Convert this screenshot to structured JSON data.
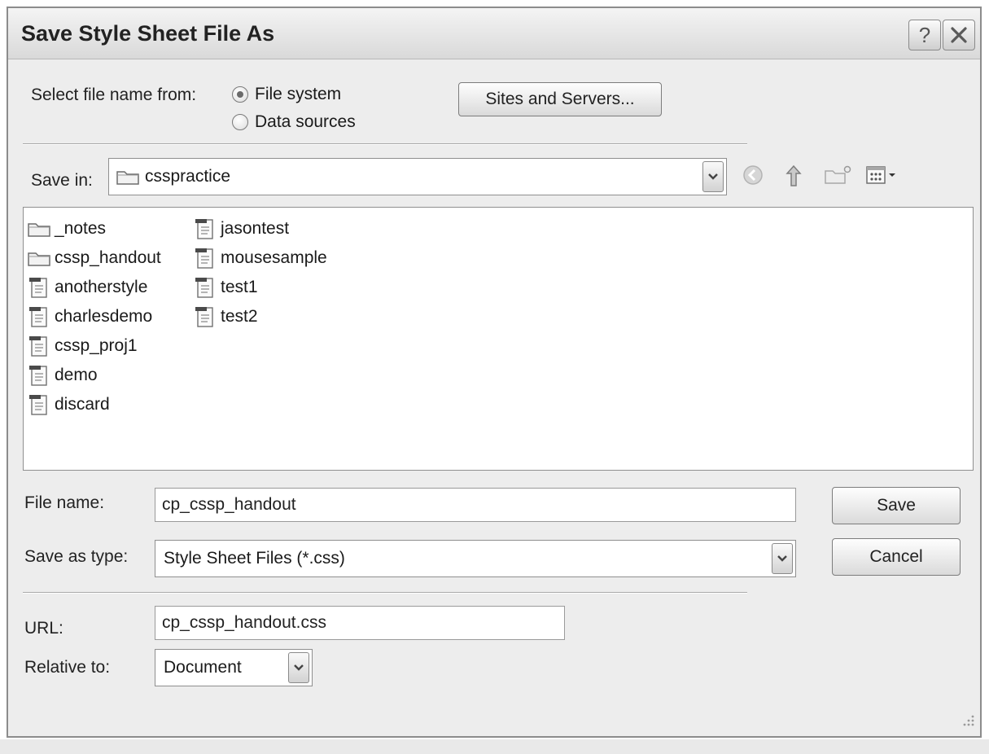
{
  "dialog": {
    "title": "Save Style Sheet File As",
    "help_label": "?"
  },
  "source": {
    "label": "Select file name from:",
    "options": [
      "File system",
      "Data sources"
    ],
    "selected": "File system",
    "sites_button": "Sites and Servers..."
  },
  "save_in": {
    "label": "Save in:",
    "folder": "csspractice"
  },
  "files": {
    "column1": [
      {
        "name": "_notes",
        "kind": "folder"
      },
      {
        "name": "cssp_handout",
        "kind": "folder"
      },
      {
        "name": "anotherstyle",
        "kind": "file"
      },
      {
        "name": "charlesdemo",
        "kind": "file"
      },
      {
        "name": "cssp_proj1",
        "kind": "file"
      },
      {
        "name": "demo",
        "kind": "file"
      },
      {
        "name": "discard",
        "kind": "file"
      }
    ],
    "column2": [
      {
        "name": "jasontest",
        "kind": "file"
      },
      {
        "name": "mousesample",
        "kind": "file"
      },
      {
        "name": "test1",
        "kind": "file"
      },
      {
        "name": "test2",
        "kind": "file"
      }
    ]
  },
  "form": {
    "file_name_label": "File name:",
    "file_name_value": "cp_cssp_handout",
    "type_label": "Save as type:",
    "type_value": "Style Sheet Files (*.css)",
    "url_label": "URL:",
    "url_value": "cp_cssp_handout.css",
    "relative_label": "Relative to:",
    "relative_value": "Document"
  },
  "buttons": {
    "save": "Save",
    "cancel": "Cancel"
  }
}
